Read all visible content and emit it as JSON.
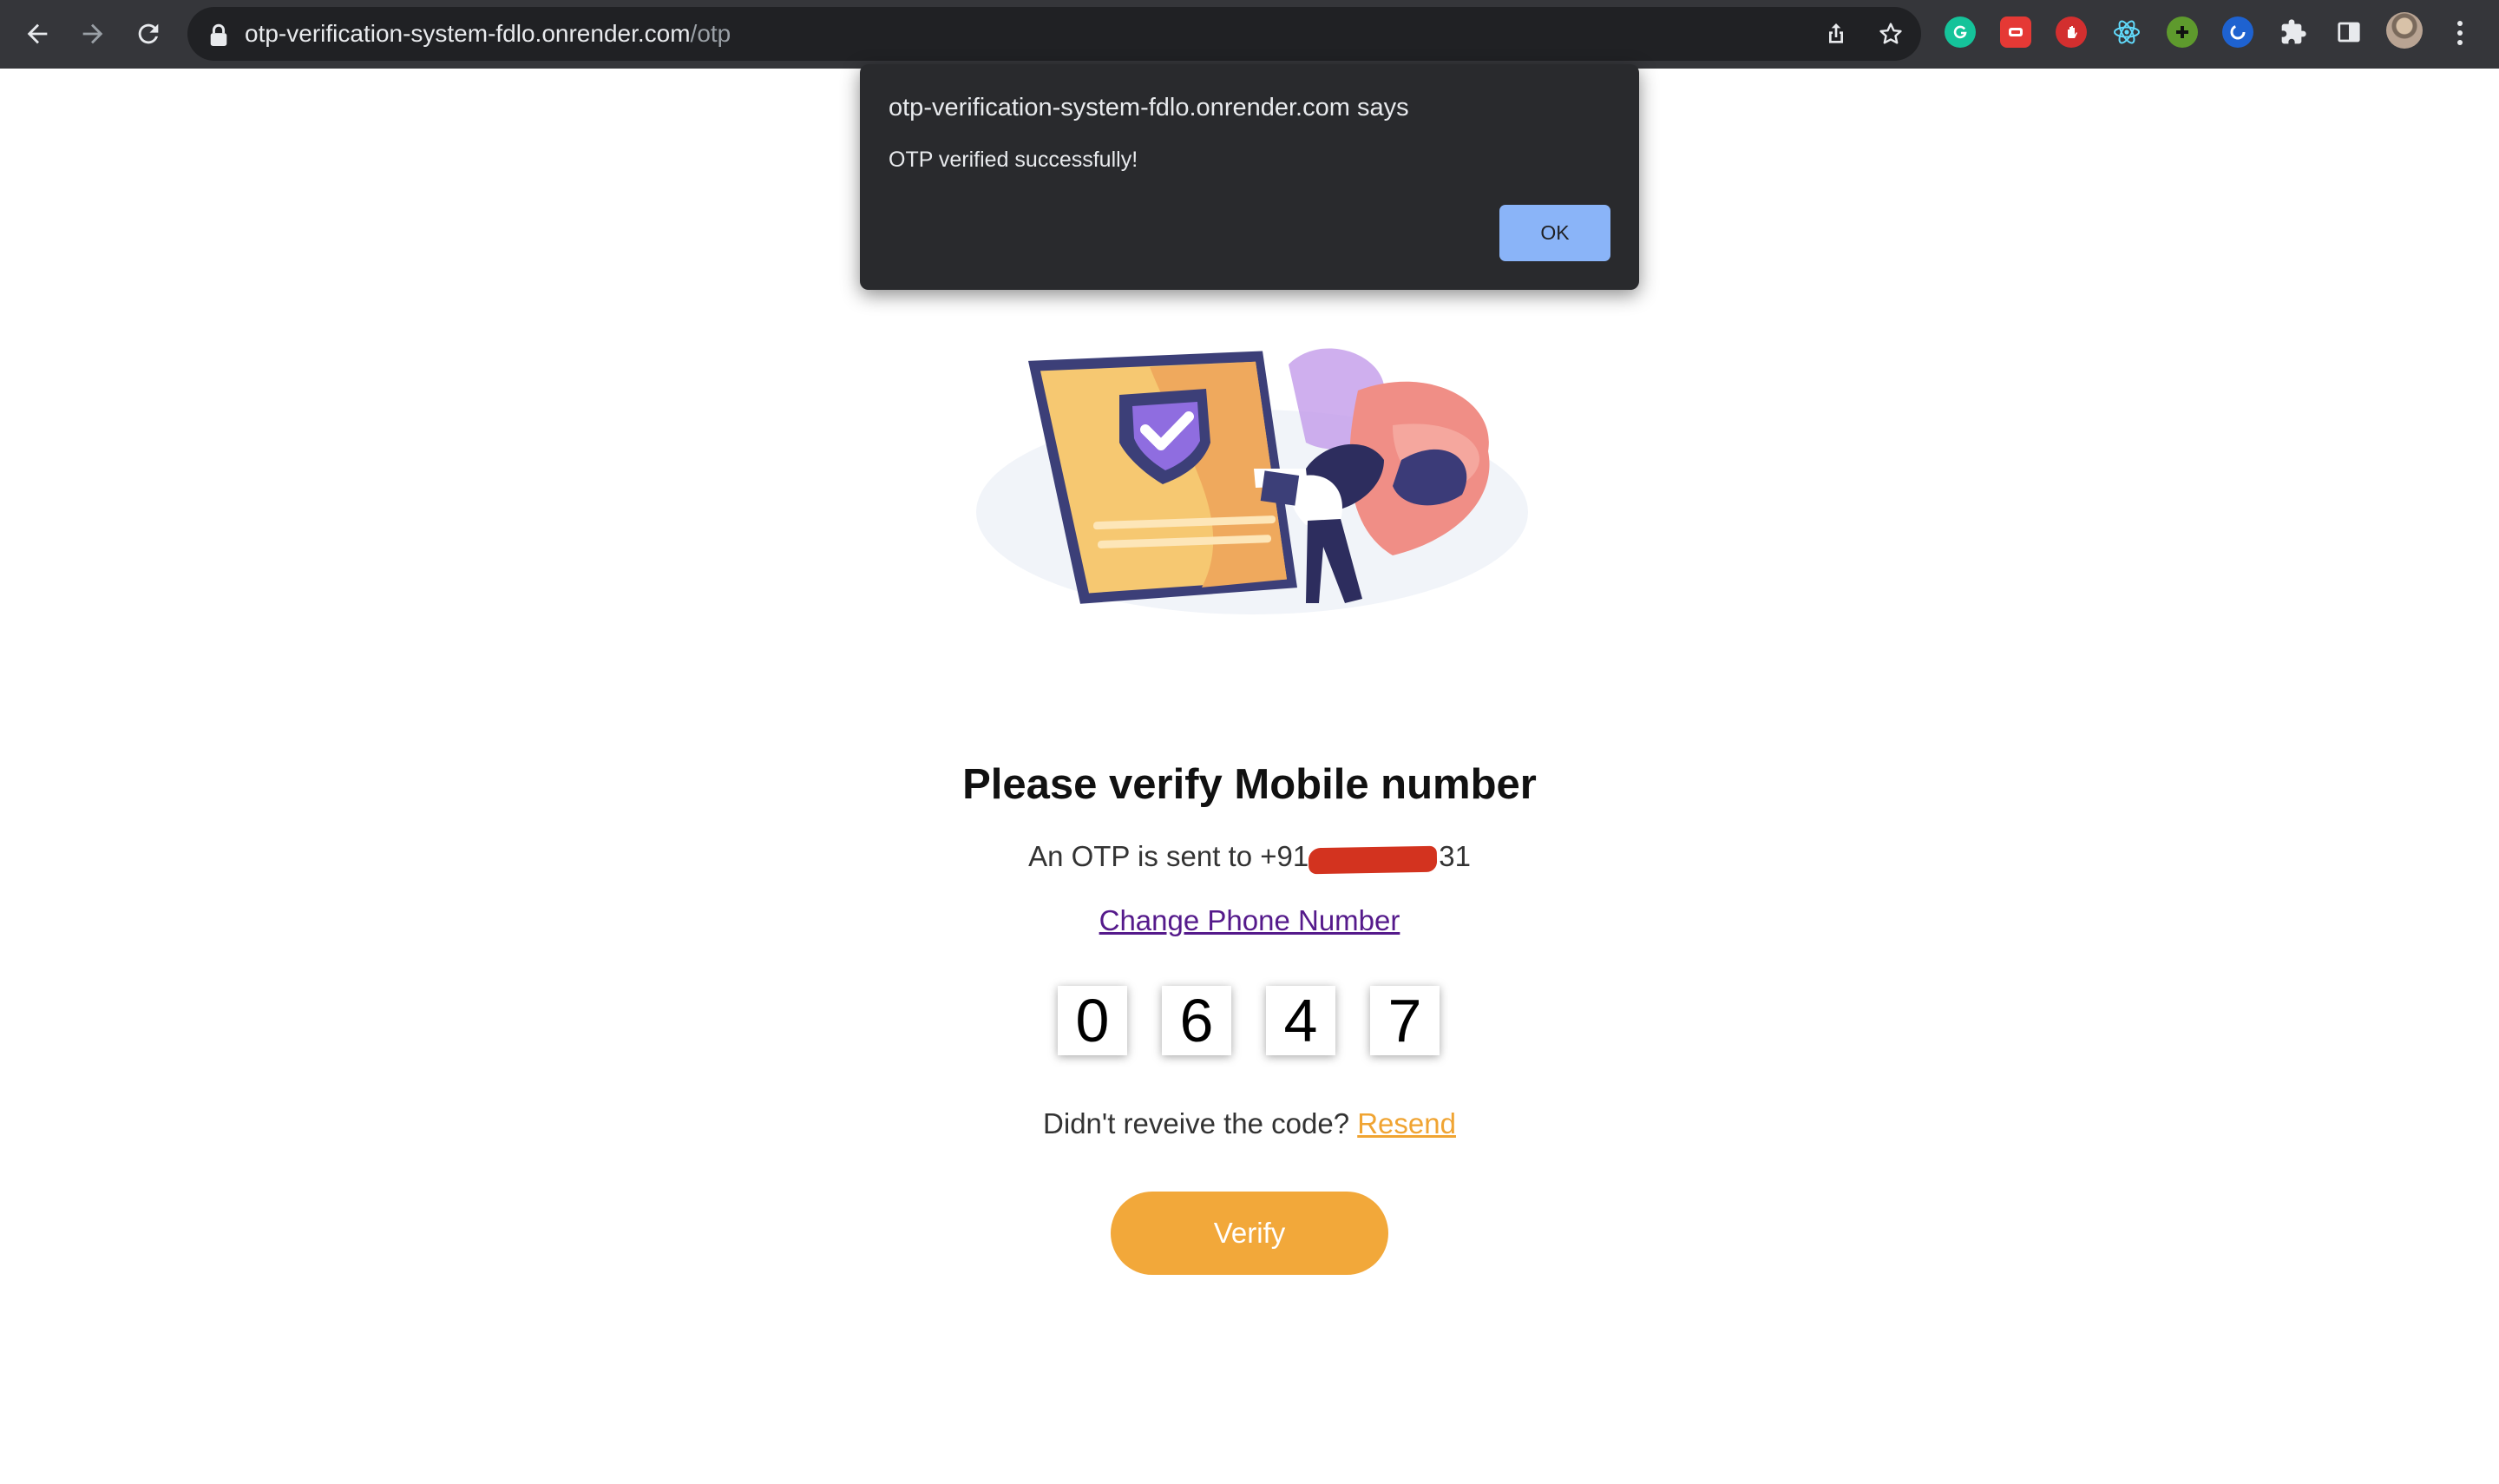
{
  "browser": {
    "url_host": "otp-verification-system-fdlo.onrender.com",
    "url_path": "/otp",
    "icons": {
      "back": "back-arrow-icon",
      "forward": "forward-arrow-icon",
      "reload": "reload-icon",
      "lock": "lock-icon",
      "share": "share-icon",
      "bookmark": "star-icon",
      "extensions": [
        "grammarly-icon",
        "red-extension-icon",
        "stop-hand-icon",
        "react-devtools-icon",
        "green-plus-icon",
        "blue-circle-icon",
        "puzzle-icon",
        "side-panel-icon",
        "profile-avatar",
        "more-menu-icon"
      ]
    }
  },
  "dialog": {
    "title": "otp-verification-system-fdlo.onrender.com says",
    "message": "OTP verified successfully!",
    "ok_label": "OK"
  },
  "page": {
    "heading": "Please verify Mobile number",
    "sent_prefix": "An OTP is sent to +91",
    "sent_suffix": "31",
    "change_link": "Change Phone Number",
    "otp_digits": [
      "0",
      "6",
      "4",
      "7"
    ],
    "resend_prompt": "Didn't reveive the code?",
    "resend_link": "Resend",
    "verify_label": "Verify"
  },
  "colors": {
    "accent": "#f2a83a",
    "link_visited": "#551a8b",
    "dialog_bg": "#292a2d",
    "ok_button": "#8ab4f8"
  }
}
